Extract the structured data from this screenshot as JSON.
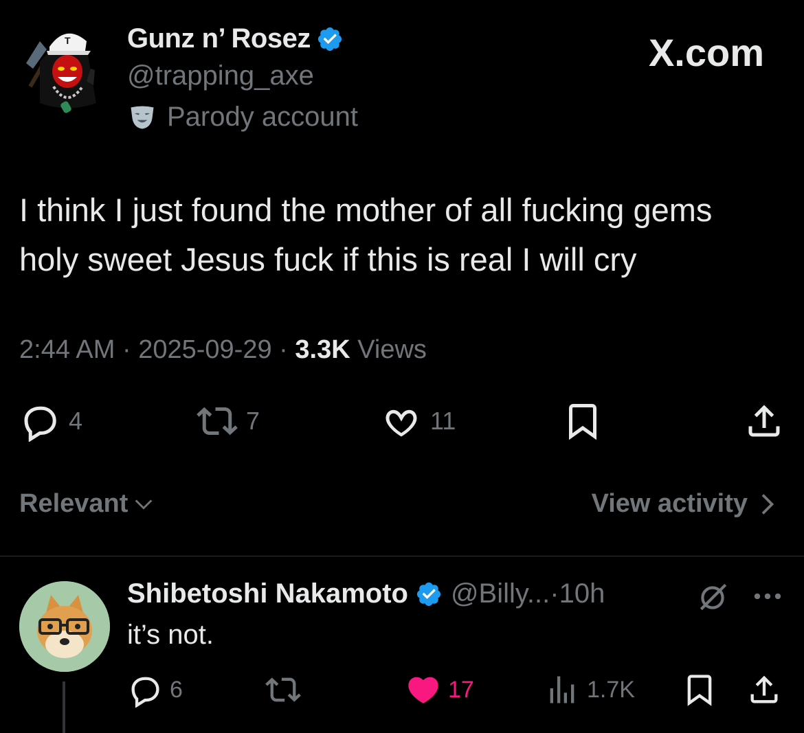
{
  "brand": {
    "site_label": "X.com"
  },
  "author": {
    "display_name": "Gunz n’ Rosez",
    "handle": "@trapping_axe",
    "parody_label": "Parody account",
    "avatar_letter": "T",
    "verified_color": "#1d9bf0"
  },
  "tweet": {
    "lines": [
      "I think I just found the mother of all fucking gems",
      "holy sweet Jesus fuck if this is real I will cry"
    ],
    "time": "2:44 AM",
    "date": "2025-09-29",
    "views_count": "3.3K",
    "views_label": "Views",
    "separator": "·",
    "replies": "4",
    "reposts": "7",
    "likes": "11"
  },
  "replies_bar": {
    "sort_label": "Relevant",
    "activity_label": "View activity"
  },
  "reply": {
    "display_name": "Shibetoshi Nakamoto",
    "handle": "@Billy...",
    "time": "10h",
    "separator": "·",
    "text": "it’s not.",
    "replies": "6",
    "likes": "17",
    "views": "1.7K",
    "like_color": "#f91880"
  },
  "colors": {
    "background": "#000000",
    "text_primary": "#e7e9ea",
    "text_secondary": "#71767b",
    "divider": "#2f3336"
  }
}
